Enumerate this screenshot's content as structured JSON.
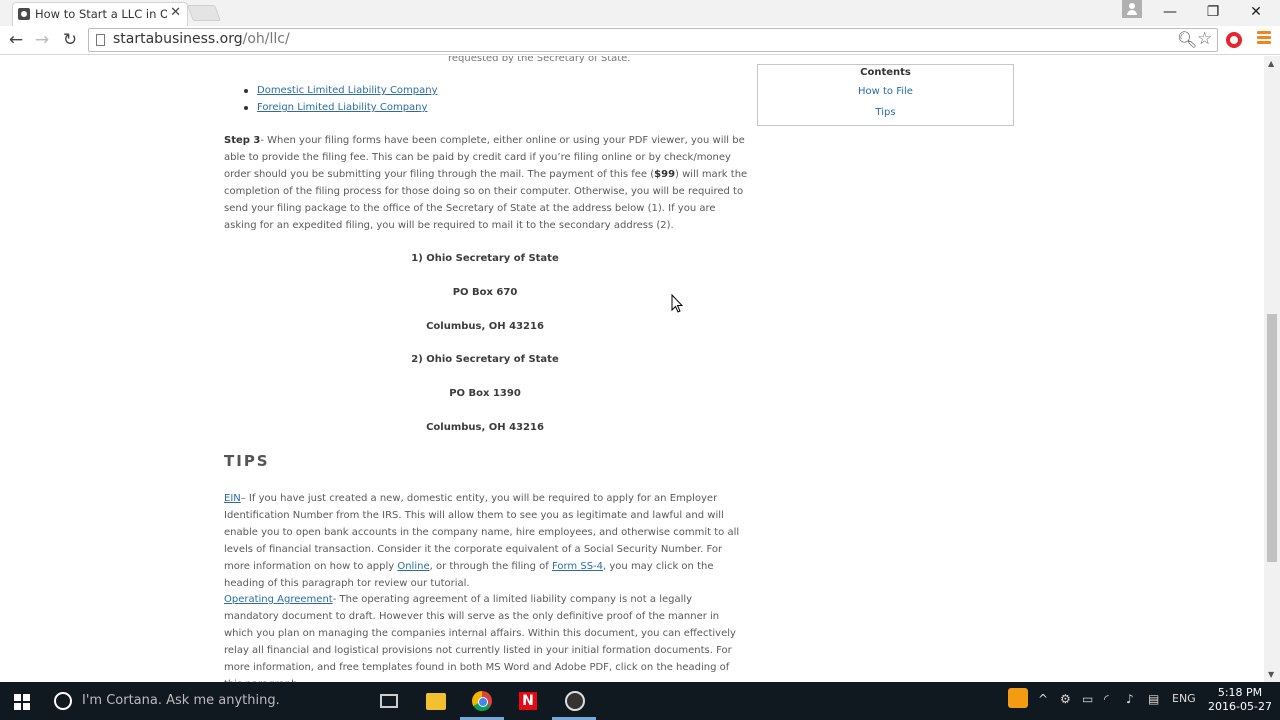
{
  "browser": {
    "tab_title": "How to Start a LLC in Ohio",
    "tab_close": "✕",
    "url_domain": "startabusiness.org",
    "url_path": "/oh/llc/",
    "window": {
      "minimize": "—",
      "restore": "❐",
      "close": "✕"
    }
  },
  "article": {
    "cutoff_text": "requested by the Secretary of State.",
    "entity_links": [
      "Domestic Limited Liability Company",
      "Foreign Limited Liability Company"
    ],
    "step3_label": "Step 3",
    "step3_text_a": "- When your filing forms have been complete, either online or using your PDF viewer, you will be able to provide the filing fee. This can be paid by credit card if you’re filing online or by check/money order should you be submitting your filing through the mail. The payment of this fee (",
    "step3_fee": "$99",
    "step3_text_b": ") will mark the completion of the filing process for those doing so on their computer. Otherwise, you will be required to send your filing package to the office of the Secretary of State at the address below (1). If you are asking for an expedited filing, you will be required to mail it to the secondary address (2).",
    "address1": [
      "1) Ohio Secretary of State",
      "PO Box 670",
      "Columbus, OH 43216"
    ],
    "address2": [
      "2) Ohio Secretary of State",
      "PO Box 1390",
      "Columbus, OH 43216"
    ],
    "tips_heading": "TIPS",
    "ein_link": "EIN",
    "ein_text_a": "– If you have just created a new, domestic entity, you will be required to apply for an Employer Identification Number from the IRS. This will allow them to see you as legitimate and lawful and will enable you to open bank accounts in the company name, hire employees, and otherwise commit to all levels of financial transaction. Consider it the corporate equivalent of a Social Security Number. For more information on how to apply ",
    "ein_online_link": "Online",
    "ein_text_b": ", or through the filing of ",
    "ein_form_link": "Form SS-4",
    "ein_text_c": ", you may click on the heading of this paragraph tor review our tutorial.",
    "oa_link": "Operating Agreement",
    "oa_text": "- The operating agreement of a limited liability company is not a legally mandatory document to draft.  However this will serve as the only definitive proof of the manner in which you plan on managing the companies internal affairs. Within this document, you can effectively relay all financial and logistical provisions not currently listed in your initial formation documents. For more information, and free templates found in both MS Word and Adobe PDF, click on the heading of this paragraph."
  },
  "toc": {
    "title": "Contents",
    "items": [
      "How to File",
      "Tips"
    ]
  },
  "taskbar": {
    "cortana_placeholder": "I'm Cortana. Ask me anything.",
    "netflix_letter": "N",
    "language": "ENG",
    "time": "5:18 PM",
    "date": "2016-05-27"
  }
}
